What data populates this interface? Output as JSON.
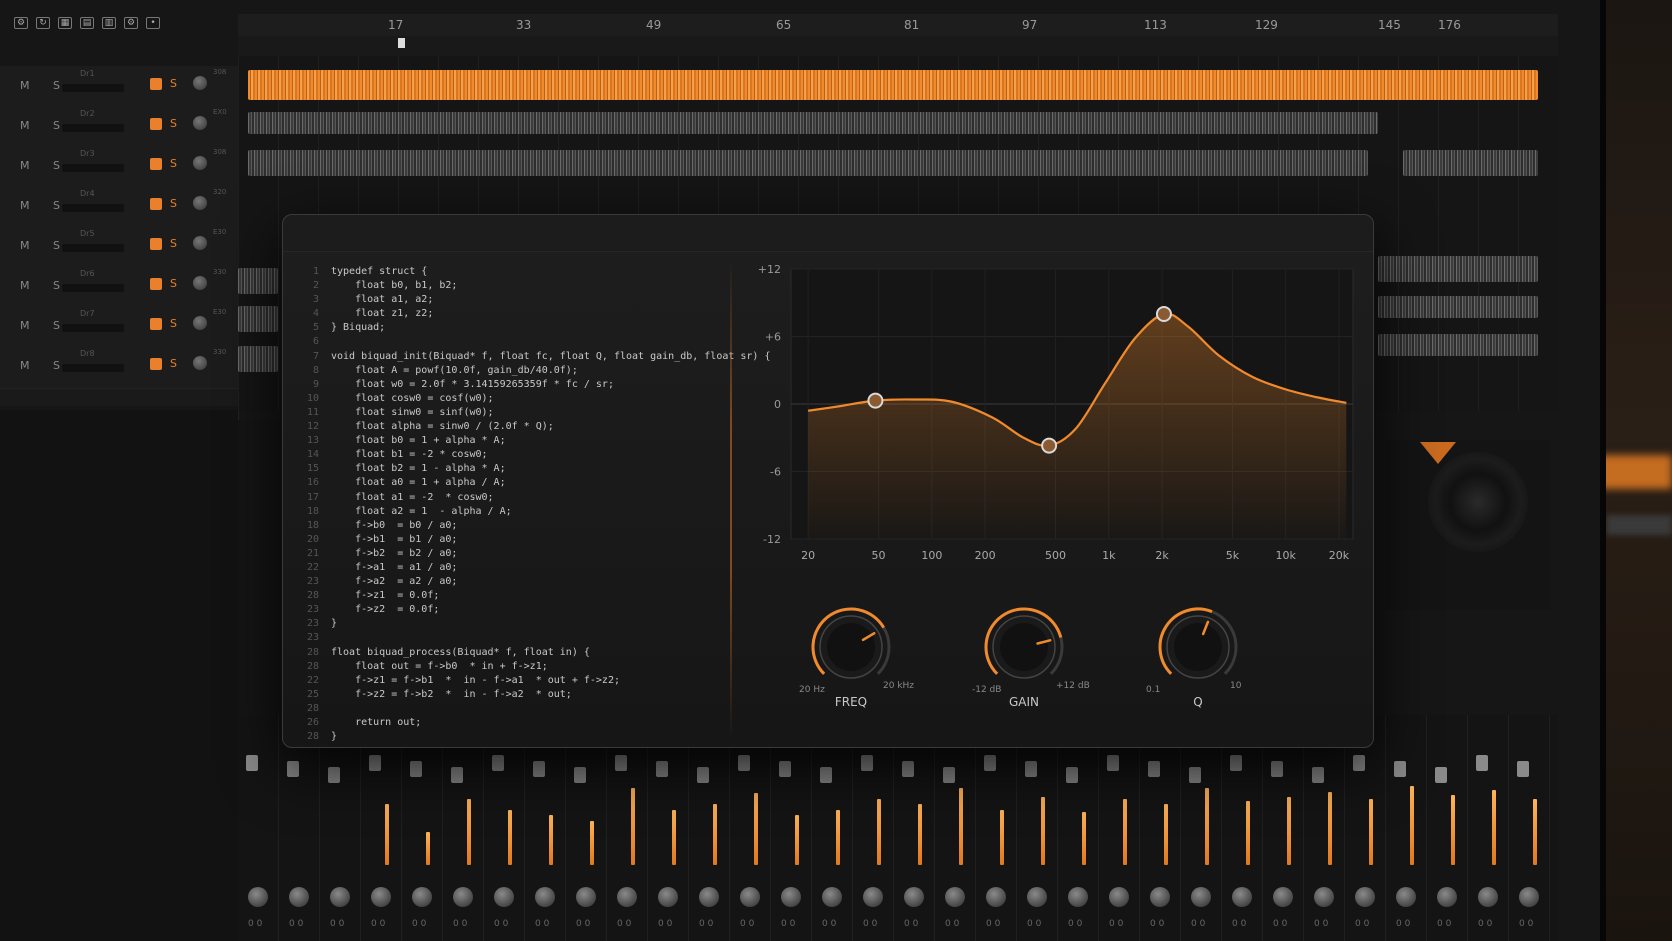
{
  "ruler": {
    "marks": [
      "17",
      "33",
      "49",
      "65",
      "81",
      "97",
      "113",
      "129",
      "145",
      "176"
    ]
  },
  "tracks": [
    {
      "ms": "M S",
      "name": "Dr1",
      "num": "308"
    },
    {
      "ms": "M S",
      "name": "Dr2",
      "num": "EX0"
    },
    {
      "ms": "M S",
      "name": "Dr3",
      "num": "308"
    },
    {
      "ms": "M S",
      "name": "Dr4",
      "num": "320"
    },
    {
      "ms": "M S",
      "name": "Dr5",
      "num": "E30"
    },
    {
      "ms": "M S",
      "name": "Dr6",
      "num": "330"
    },
    {
      "ms": "M S",
      "name": "Dr7",
      "num": "E30"
    },
    {
      "ms": "M S",
      "name": "Dr8",
      "num": "330"
    }
  ],
  "code": [
    {
      "n": "1",
      "t": "typedef struct {"
    },
    {
      "n": "2",
      "t": "    float b0, b1, b2;"
    },
    {
      "n": "3",
      "t": "    float a1, a2;"
    },
    {
      "n": "4",
      "t": "    float z1, z2;"
    },
    {
      "n": "5",
      "t": "} Biquad;"
    },
    {
      "n": "6",
      "t": ""
    },
    {
      "n": "7",
      "t": "void biquad_init(Biquad* f, float fc, float Q, float gain_db, float sr) {"
    },
    {
      "n": "8",
      "t": "    float A = powf(10.0f, gain_db/40.0f);"
    },
    {
      "n": "9",
      "t": "    float w0 = 2.0f * 3.14159265359f * fc / sr;"
    },
    {
      "n": "10",
      "t": "    float cosw0 = cosf(w0);"
    },
    {
      "n": "11",
      "t": "    float sinw0 = sinf(w0);"
    },
    {
      "n": "12",
      "t": "    float alpha = sinw0 / (2.0f * Q);"
    },
    {
      "n": "13",
      "t": "    float b0 = 1 + alpha * A;"
    },
    {
      "n": "14",
      "t": "    float b1 = -2 * cosw0;"
    },
    {
      "n": "15",
      "t": "    float b2 = 1 - alpha * A;"
    },
    {
      "n": "16",
      "t": "    float a0 = 1 + alpha / A;"
    },
    {
      "n": "17",
      "t": "    float a1 = -2  * cosw0;"
    },
    {
      "n": "18",
      "t": "    float a2 = 1  - alpha / A;"
    },
    {
      "n": "18",
      "t": "    f->b0  = b0 / a0;"
    },
    {
      "n": "20",
      "t": "    f->b1  = b1 / a0;"
    },
    {
      "n": "21",
      "t": "    f->b2  = b2 / a0;"
    },
    {
      "n": "22",
      "t": "    f->a1  = a1 / a0;"
    },
    {
      "n": "23",
      "t": "    f->a2  = a2 / a0;"
    },
    {
      "n": "28",
      "t": "    f->z1  = 0.0f;"
    },
    {
      "n": "23",
      "t": "    f->z2  = 0.0f;"
    },
    {
      "n": "23",
      "t": "}"
    },
    {
      "n": "23",
      "t": ""
    },
    {
      "n": "28",
      "t": "float biquad_process(Biquad* f, float in) {"
    },
    {
      "n": "28",
      "t": "    float out = f->b0  * in + f->z1;"
    },
    {
      "n": "22",
      "t": "    f->z1 = f->b1  *  in - f->a1  * out + f->z2;"
    },
    {
      "n": "25",
      "t": "    f->z2 = f->b2  *  in - f->a2  * out;"
    },
    {
      "n": "28",
      "t": ""
    },
    {
      "n": "26",
      "t": "    return out;"
    },
    {
      "n": "28",
      "t": "}"
    }
  ],
  "eq": {
    "y_ticks": [
      "+12",
      "+6",
      "0",
      "-6",
      "-12"
    ],
    "y_values": [
      12,
      6,
      0,
      -6,
      -12
    ],
    "x_ticks": [
      "20",
      "50",
      "100",
      "200",
      "500",
      "1k",
      "2k",
      "5k",
      "10k",
      "20k"
    ],
    "x_values": [
      20,
      50,
      100,
      200,
      500,
      1000,
      2000,
      5000,
      10000,
      20000
    ],
    "curve_color": "#f08a2c",
    "nodes": [
      {
        "freq": 48,
        "gain": 0.3
      },
      {
        "freq": 460,
        "gain": -3.7
      },
      {
        "freq": 2050,
        "gain": 8.0
      }
    ],
    "curve": [
      {
        "freq": 20,
        "gain": -0.6
      },
      {
        "freq": 30,
        "gain": -0.2
      },
      {
        "freq": 48,
        "gain": 0.3
      },
      {
        "freq": 80,
        "gain": 0.4
      },
      {
        "freq": 130,
        "gain": 0.2
      },
      {
        "freq": 220,
        "gain": -1.2
      },
      {
        "freq": 330,
        "gain": -3.0
      },
      {
        "freq": 460,
        "gain": -3.7
      },
      {
        "freq": 650,
        "gain": -2.2
      },
      {
        "freq": 950,
        "gain": 1.8
      },
      {
        "freq": 1400,
        "gain": 5.8
      },
      {
        "freq": 2050,
        "gain": 8.0
      },
      {
        "freq": 2800,
        "gain": 6.9
      },
      {
        "freq": 4200,
        "gain": 4.3
      },
      {
        "freq": 6500,
        "gain": 2.4
      },
      {
        "freq": 10000,
        "gain": 1.3
      },
      {
        "freq": 15000,
        "gain": 0.6
      },
      {
        "freq": 22000,
        "gain": 0.1
      }
    ]
  },
  "knobs": [
    {
      "label": "FREQ",
      "min": "20 Hz",
      "max": "20 kHz",
      "value": 0.72
    },
    {
      "label": "GAIN",
      "min": "-12 dB",
      "max": "+12 dB",
      "value": 0.78
    },
    {
      "label": "Q",
      "min": "0.1",
      "max": "10",
      "value": 0.58
    }
  ],
  "mixer": {
    "strips": [
      {
        "meter": 0.0,
        "label": "0 0"
      },
      {
        "meter": 0.0,
        "label": "0 0"
      },
      {
        "meter": 0.0,
        "label": "0 0"
      },
      {
        "meter": 0.55,
        "label": "0 0"
      },
      {
        "meter": 0.3,
        "label": "0 0"
      },
      {
        "meter": 0.6,
        "label": "0 0"
      },
      {
        "meter": 0.5,
        "label": "0 0"
      },
      {
        "meter": 0.45,
        "label": "0 0"
      },
      {
        "meter": 0.4,
        "label": "0 0"
      },
      {
        "meter": 0.7,
        "label": "0 0"
      },
      {
        "meter": 0.5,
        "label": "0 0"
      },
      {
        "meter": 0.55,
        "label": "0 0"
      },
      {
        "meter": 0.65,
        "label": "0 0"
      },
      {
        "meter": 0.45,
        "label": "0 0"
      },
      {
        "meter": 0.5,
        "label": "0 0"
      },
      {
        "meter": 0.6,
        "label": "0 0"
      },
      {
        "meter": 0.55,
        "label": "0 0"
      },
      {
        "meter": 0.7,
        "label": "0 0"
      },
      {
        "meter": 0.5,
        "label": "0 0"
      },
      {
        "meter": 0.62,
        "label": "0 0"
      },
      {
        "meter": 0.48,
        "label": "0 0"
      },
      {
        "meter": 0.6,
        "label": "0 0"
      },
      {
        "meter": 0.55,
        "label": "0 0"
      },
      {
        "meter": 0.7,
        "label": "0 0"
      },
      {
        "meter": 0.58,
        "label": "0 0"
      },
      {
        "meter": 0.62,
        "label": "0 0"
      },
      {
        "meter": 0.66,
        "label": "0 0"
      },
      {
        "meter": 0.6,
        "label": "0 0"
      },
      {
        "meter": 0.72,
        "label": "0 0"
      },
      {
        "meter": 0.64,
        "label": "0 0"
      },
      {
        "meter": 0.68,
        "label": "0 0"
      },
      {
        "meter": 0.6,
        "label": "0 0"
      }
    ]
  }
}
